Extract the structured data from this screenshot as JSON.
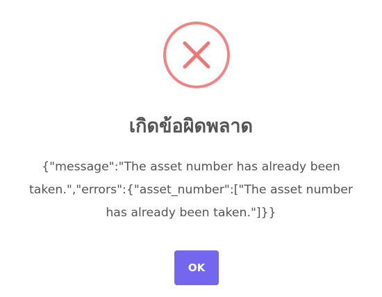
{
  "dialog": {
    "icon": "error-x-icon",
    "title": "เกิดข้อผิดพลาด",
    "message": "{\"message\":\"The asset number has already been taken.\",\"errors\":{\"asset_number\":[\"The asset number has already been taken.\"]}}",
    "confirm_label": "OK"
  },
  "colors": {
    "error_icon": "#f27474",
    "title_text": "#545454",
    "confirm_button": "#7367f0",
    "confirm_text": "#ffffff"
  }
}
